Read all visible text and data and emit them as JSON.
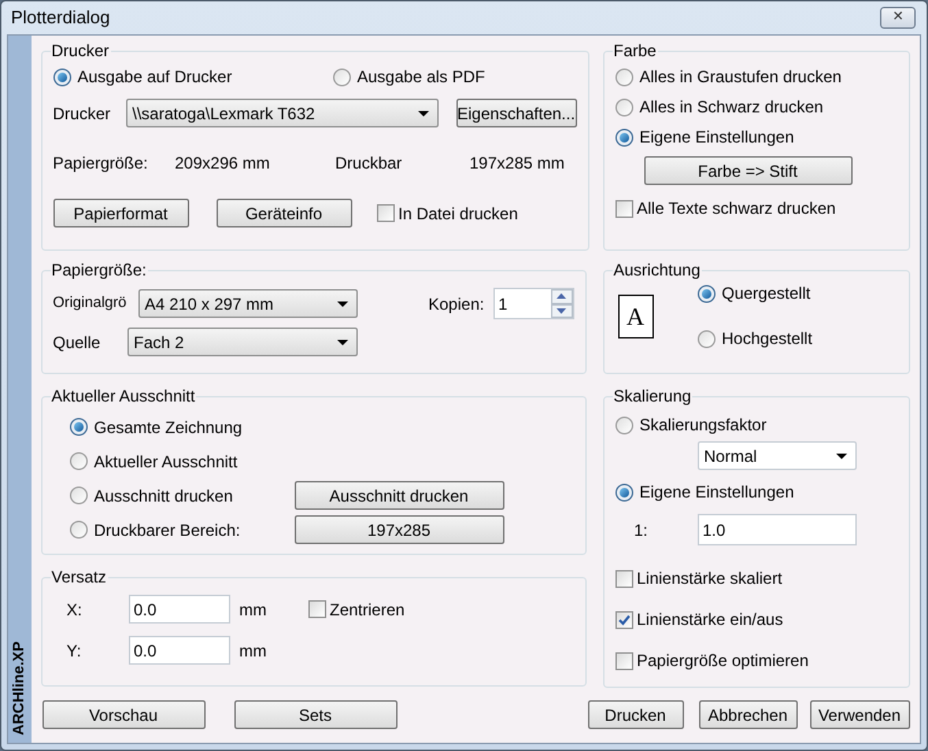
{
  "window": {
    "title": "Plotterdialog",
    "close": "✕"
  },
  "side_label": "ARCHline.XP",
  "printer": {
    "title": "Drucker",
    "output": [
      {
        "label": "Ausgabe auf Drucker",
        "selected": true
      },
      {
        "label": "Ausgabe als PDF",
        "selected": false
      }
    ],
    "printer_label": "Drucker",
    "printer_value": "\\\\saratoga\\Lexmark T632",
    "properties_button": "Eigenschaften...",
    "paper_label": "Papiergröße:",
    "paper_value": "209x296 mm",
    "printable_label": "Druckbar",
    "printable_value": "197x285 mm",
    "buttons": [
      "Papierformat",
      "Geräteinfo"
    ],
    "to_file": {
      "label": "In Datei drucken",
      "checked": false
    }
  },
  "paper": {
    "title": "Papiergröße:",
    "original_label": "Originalgrö",
    "original_value": "A4 210 x 297 mm",
    "copies_label": "Kopien:",
    "copies_value": "1",
    "source_label": "Quelle",
    "source_value": "Fach 2"
  },
  "area": {
    "title": "Aktueller Ausschnitt",
    "options": [
      {
        "label": "Gesamte Zeichnung",
        "selected": true
      },
      {
        "label": "Aktueller Ausschnitt",
        "selected": false
      },
      {
        "label": "Ausschnitt drucken",
        "selected": false,
        "button": "Ausschnitt drucken"
      },
      {
        "label": "Druckbarer Bereich:",
        "selected": false,
        "button": "197x285"
      }
    ]
  },
  "offset": {
    "title": "Versatz",
    "fields": [
      {
        "label": "X:",
        "value": "0.0",
        "unit": "mm"
      },
      {
        "label": "Y:",
        "value": "0.0",
        "unit": "mm"
      }
    ],
    "center": {
      "label": "Zentrieren",
      "checked": false
    }
  },
  "color": {
    "title": "Farbe",
    "options": [
      {
        "label": "Alles in Graustufen drucken",
        "selected": false
      },
      {
        "label": "Alles in Schwarz drucken",
        "selected": false
      },
      {
        "label": "Eigene Einstellungen",
        "selected": true
      }
    ],
    "button": "Farbe => Stift",
    "black_text": {
      "label": "Alle Texte schwarz drucken",
      "checked": false
    }
  },
  "orientation": {
    "title": "Ausrichtung",
    "icon_letter": "A",
    "options": [
      {
        "label": "Quergestellt",
        "selected": true
      },
      {
        "label": "Hochgestellt",
        "selected": false
      }
    ]
  },
  "scaling": {
    "title": "Skalierung",
    "factor": {
      "label": "Skalierungsfaktor",
      "selected": false
    },
    "factor_value": "Normal",
    "custom": {
      "label": "Eigene Einstellungen",
      "selected": true
    },
    "ratio_label": "1:",
    "ratio_value": "1.0",
    "checks": [
      {
        "label": "Linienstärke skaliert",
        "checked": false
      },
      {
        "label": "Linienstärke ein/aus",
        "checked": true
      },
      {
        "label": "Papiergröße optimieren",
        "checked": false
      }
    ]
  },
  "footer": {
    "left": [
      "Vorschau",
      "Sets"
    ],
    "right": [
      "Drucken",
      "Abbrechen",
      "Verwenden"
    ]
  }
}
